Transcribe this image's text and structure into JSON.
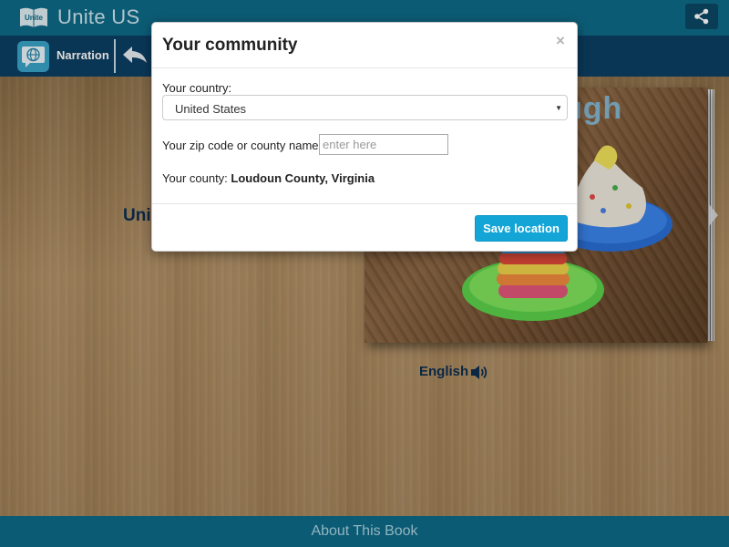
{
  "app": {
    "logo_text": "Unite",
    "title": "Unite US"
  },
  "toolbar": {
    "narration_label": "Narration"
  },
  "page": {
    "left_title_visible": "Unit",
    "cover_title_visible": "ugh",
    "language_label": "English"
  },
  "footer": {
    "about_label": "About This Book"
  },
  "modal": {
    "title": "Your community",
    "close_symbol": "×",
    "country_label": "Your country:",
    "country_value": "United States",
    "zip_label": "Your zip code or county name:",
    "zip_placeholder": "enter here",
    "county_label": "Your county:",
    "county_value": "Loudoun County, Virginia",
    "save_label": "Save location"
  },
  "colors": {
    "header": "#0f6a87",
    "toolbar": "#0c3f63",
    "accent_button": "#12a5d6",
    "title_text": "#0e2e50"
  },
  "icons": [
    "book-logo-icon",
    "share-icon",
    "globe-chat-icon",
    "back-arrow-icon",
    "next-arrow-icon",
    "speaker-icon",
    "close-icon",
    "chevron-down-icon"
  ]
}
